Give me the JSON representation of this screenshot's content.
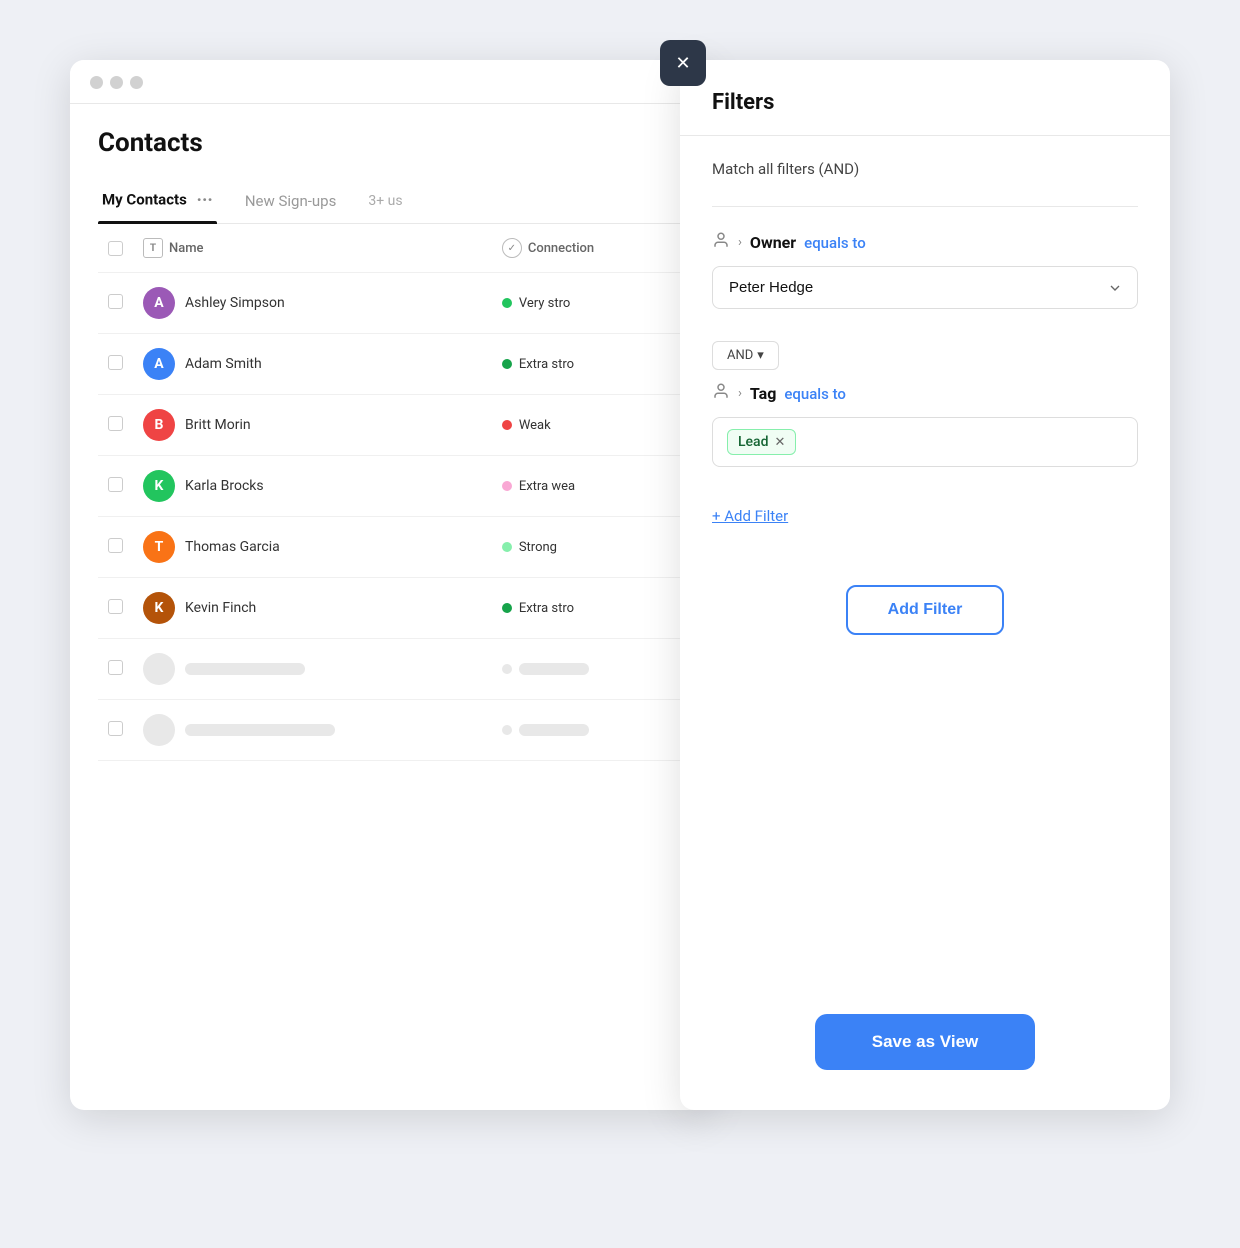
{
  "app": {
    "title": "Contacts"
  },
  "tabs": [
    {
      "id": "my-contacts",
      "label": "My Contacts",
      "active": true,
      "dots": "···"
    },
    {
      "id": "new-signups",
      "label": "New Sign-ups",
      "active": false
    },
    {
      "id": "more",
      "label": "3+ us",
      "active": false
    }
  ],
  "table": {
    "columns": [
      {
        "id": "name",
        "label": "Name",
        "icon": "T"
      },
      {
        "id": "connection",
        "label": "Connection",
        "icon": "✓"
      }
    ],
    "rows": [
      {
        "id": 1,
        "name": "Ashley Simpson",
        "avatar_letter": "A",
        "avatar_color": "#9b59b6",
        "strength": "Very stro",
        "strength_color": "#22c55e"
      },
      {
        "id": 2,
        "name": "Adam Smith",
        "avatar_letter": "A",
        "avatar_color": "#3b82f6",
        "strength": "Extra stro",
        "strength_color": "#16a34a"
      },
      {
        "id": 3,
        "name": "Britt Morin",
        "avatar_letter": "B",
        "avatar_color": "#ef4444",
        "strength": "Weak",
        "strength_color": "#ef4444"
      },
      {
        "id": 4,
        "name": "Karla Brocks",
        "avatar_letter": "K",
        "avatar_color": "#22c55e",
        "strength": "Extra wea",
        "strength_color": "#f9a8d4"
      },
      {
        "id": 5,
        "name": "Thomas Garcia",
        "avatar_letter": "T",
        "avatar_color": "#f97316",
        "strength": "Strong",
        "strength_color": "#86efac"
      },
      {
        "id": 6,
        "name": "Kevin Finch",
        "avatar_letter": "K",
        "avatar_color": "#b45309",
        "strength": "Extra stro",
        "strength_color": "#16a34a"
      }
    ]
  },
  "filters": {
    "panel_title": "Filters",
    "match_label": "Match all filters (AND)",
    "filter1": {
      "icon": "person",
      "field": "Owner",
      "op": "equals to",
      "value": "Peter Hedge"
    },
    "and_label": "AND",
    "filter2": {
      "icon": "person",
      "field": "Tag",
      "op": "equals to",
      "tag_value": "Lead"
    },
    "add_filter_link": "+ Add Filter",
    "add_filter_btn": "Add Filter",
    "save_view_btn": "Save as View"
  }
}
